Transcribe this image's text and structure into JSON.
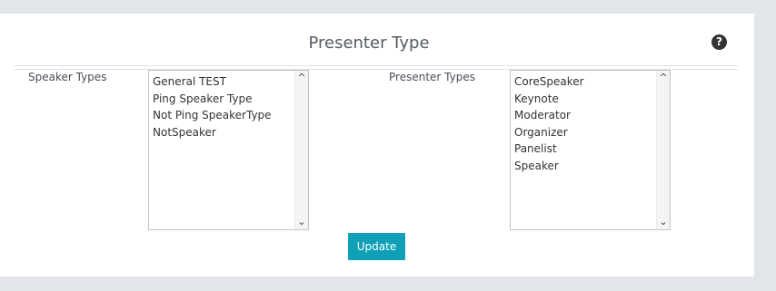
{
  "page": {
    "title": "Presenter Type"
  },
  "icons": {
    "help": "?"
  },
  "speaker_types": {
    "label": "Speaker Types",
    "options": [
      "General TEST",
      "Ping Speaker Type",
      "Not Ping SpeakerType",
      "NotSpeaker"
    ]
  },
  "presenter_types": {
    "label": "Presenter Types",
    "options": [
      "CoreSpeaker",
      "Keynote",
      "Moderator",
      "Organizer",
      "Panelist",
      "Speaker"
    ]
  },
  "scroll": {
    "up": "^",
    "down": "⌄"
  },
  "actions": {
    "update_label": "Update"
  },
  "colors": {
    "accent": "#0fa0b7",
    "background": "#e2e5ea",
    "panel": "#ffffff"
  }
}
